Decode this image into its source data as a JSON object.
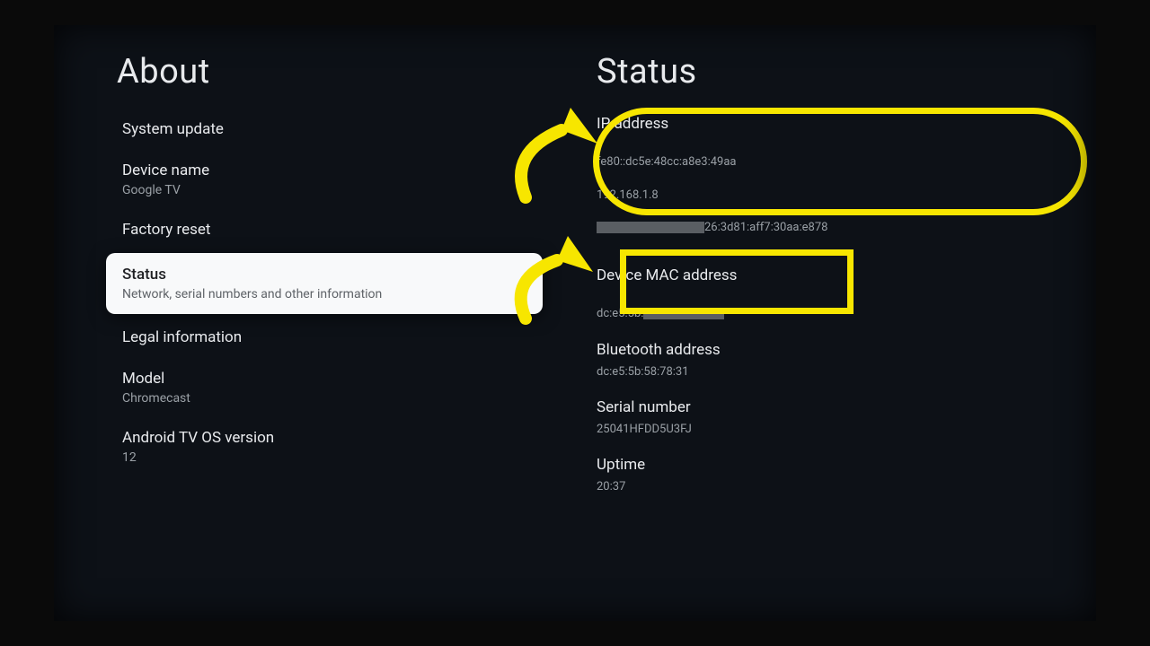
{
  "about": {
    "title": "About",
    "items": [
      {
        "label": "System update",
        "sub": ""
      },
      {
        "label": "Device name",
        "sub": "Google TV"
      },
      {
        "label": "Factory reset",
        "sub": ""
      },
      {
        "label": "Status",
        "sub": "Network, serial numbers and other information",
        "selected": true
      },
      {
        "label": "Legal information",
        "sub": ""
      },
      {
        "label": "Model",
        "sub": "Chromecast"
      },
      {
        "label": "Android TV OS version",
        "sub": "12"
      }
    ]
  },
  "status": {
    "title": "Status",
    "ip": {
      "label": "IP address",
      "line1": "fe80::dc5e:48cc:a8e3:49aa",
      "line2": "192.168.1.8",
      "line3_suffix": "26:3d81:aff7:30aa:e878"
    },
    "mac": {
      "label": "Device MAC address",
      "prefix": "dc:e5:5b:"
    },
    "bt": {
      "label": "Bluetooth address",
      "value": "dc:e5:5b:58:78:31"
    },
    "serial": {
      "label": "Serial number",
      "value": "25041HFDD5U3FJ"
    },
    "uptime": {
      "label": "Uptime",
      "value": "20:37"
    }
  },
  "annotation_color": "#f7e600"
}
